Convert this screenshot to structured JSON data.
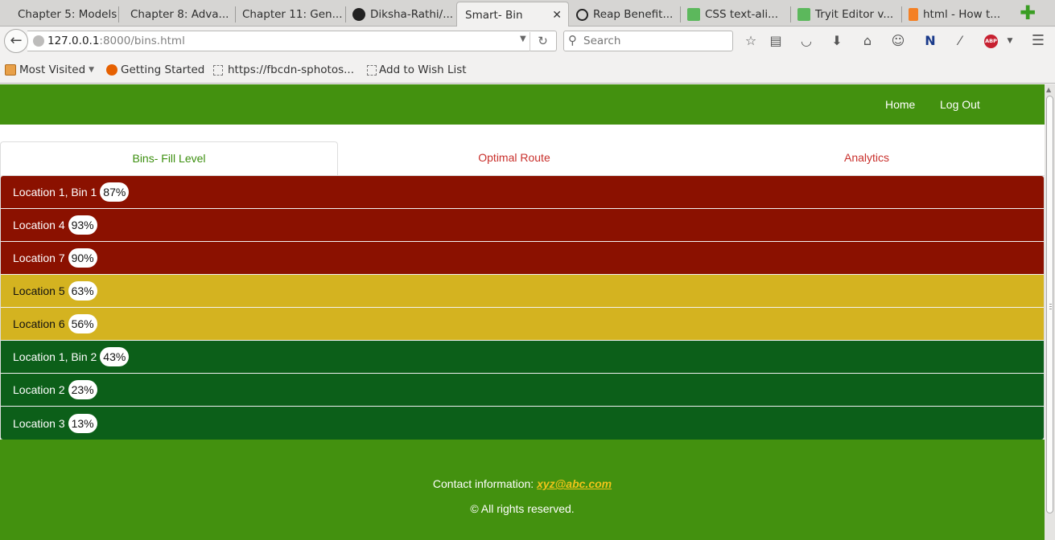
{
  "browser": {
    "tabs": [
      {
        "title": "Chapter 5: Models",
        "icon": "page-icon"
      },
      {
        "title": "Chapter 8: Adva...",
        "icon": "page-icon"
      },
      {
        "title": "Chapter 11: Gen...",
        "icon": "page-icon"
      },
      {
        "title": "Diksha-Rathi/...",
        "icon": "github-icon"
      },
      {
        "title": "Smart- Bin",
        "icon": "page-icon",
        "active": true
      },
      {
        "title": "Reap Benefit...",
        "icon": "reap-icon"
      },
      {
        "title": "CSS text-ali...",
        "icon": "w3schools-icon"
      },
      {
        "title": "Tryit Editor v...",
        "icon": "w3schools-icon"
      },
      {
        "title": "html - How t...",
        "icon": "stackoverflow-icon"
      }
    ],
    "close_glyph": "✕",
    "new_tab_glyph": "✚",
    "url_host": "127.0.0.1",
    "url_rest": ":8000/bins.html",
    "search_placeholder": "Search",
    "bookmarks": [
      {
        "label": "Most Visited",
        "icon": "most-visited-icon"
      },
      {
        "label": "Getting Started",
        "icon": "firefox-icon"
      },
      {
        "label": "https://fbcdn-sphotos...",
        "icon": "bookmark-blank-icon"
      },
      {
        "label": "Add to Wish List",
        "icon": "bookmark-blank-icon"
      }
    ],
    "toolbar_icons": [
      "bookmark-star-icon",
      "reading-list-icon",
      "pocket-icon",
      "downloads-icon",
      "home-icon",
      "chat-icon",
      "n-extension-icon",
      "wand-icon",
      "adblock-icon",
      "menu-icon"
    ],
    "abp_label": "ABP"
  },
  "header": {
    "links": [
      "Home",
      "Log Out"
    ],
    "bg_color": "#43910f"
  },
  "tabs": [
    {
      "label": "Bins- Fill Level",
      "active": true
    },
    {
      "label": "Optimal Route",
      "active": false
    },
    {
      "label": "Analytics",
      "active": false
    }
  ],
  "bins": [
    {
      "name": "Location 1, Bin 1",
      "fill": "87%",
      "level": "high"
    },
    {
      "name": "Location 4",
      "fill": "93%",
      "level": "high"
    },
    {
      "name": "Location 7",
      "fill": "90%",
      "level": "high"
    },
    {
      "name": "Location 5",
      "fill": "63%",
      "level": "medium"
    },
    {
      "name": "Location 6",
      "fill": "56%",
      "level": "medium"
    },
    {
      "name": "Location 1, Bin 2",
      "fill": "43%",
      "level": "low"
    },
    {
      "name": "Location 2",
      "fill": "23%",
      "level": "low"
    },
    {
      "name": "Location 3",
      "fill": "13%",
      "level": "low"
    }
  ],
  "level_colors": {
    "high": "#8b1100",
    "medium": "#d4b320",
    "low": "#0c5f19"
  },
  "footer": {
    "contact_label": "Contact information:",
    "contact_email": "xyz@abc.com",
    "rights": "© All rights reserved."
  }
}
